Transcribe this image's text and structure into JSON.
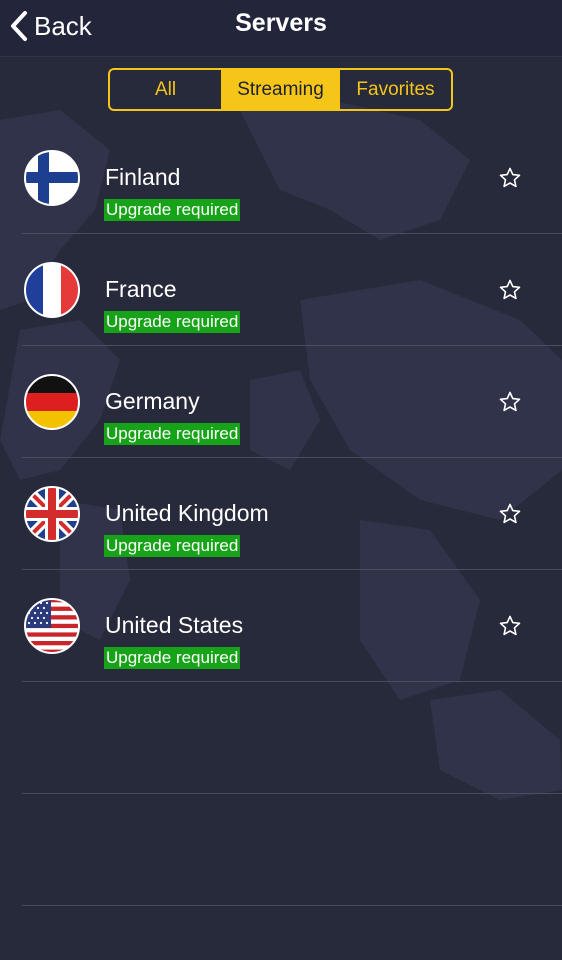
{
  "header": {
    "back_label": "Back",
    "title": "Servers"
  },
  "tabs": [
    {
      "label": "All",
      "selected": false
    },
    {
      "label": "Streaming",
      "selected": true
    },
    {
      "label": "Favorites",
      "selected": false
    }
  ],
  "servers": [
    {
      "name": "Finland",
      "status": "Upgrade required",
      "flag": "finland-flag"
    },
    {
      "name": "France",
      "status": "Upgrade required",
      "flag": "france-flag"
    },
    {
      "name": "Germany",
      "status": "Upgrade required",
      "flag": "germany-flag"
    },
    {
      "name": "United Kingdom",
      "status": "Upgrade required",
      "flag": "uk-flag"
    },
    {
      "name": "United States",
      "status": "Upgrade required",
      "flag": "us-flag"
    }
  ],
  "colors": {
    "accent": "#f5c518",
    "background": "#272a3b",
    "badge": "#17a317"
  }
}
